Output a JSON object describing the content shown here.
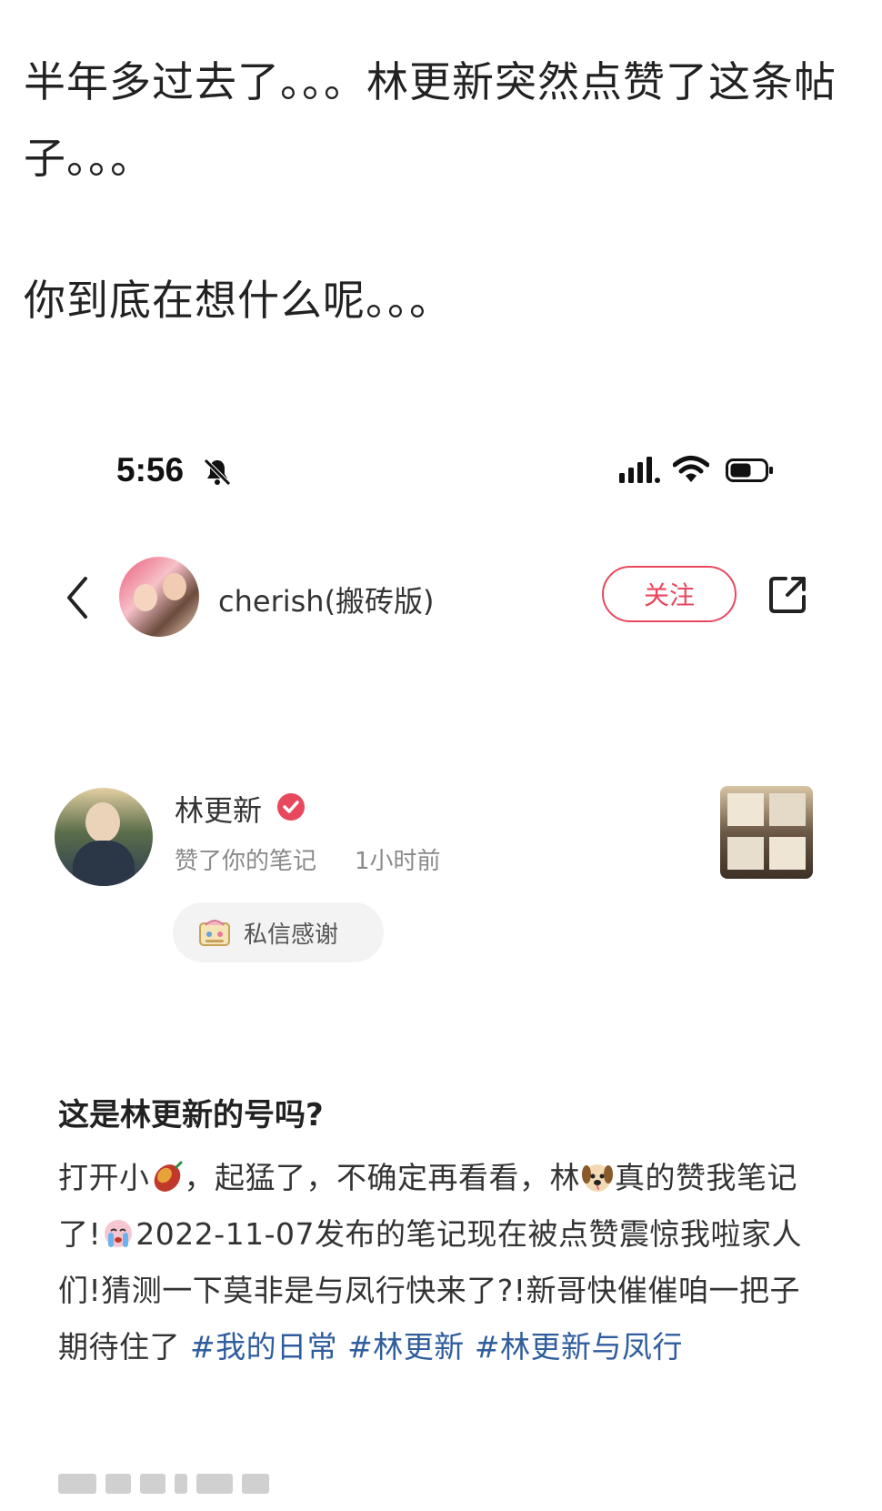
{
  "caption": {
    "line1": "半年多过去了。。。林更新突然点赞了这条帖子。。。",
    "line2": "你到底在想什么呢。。。"
  },
  "status_bar": {
    "time": "5:56",
    "icons": [
      "bell-slash-icon",
      "signal-icon",
      "wifi-icon",
      "battery-icon"
    ]
  },
  "header": {
    "back_icon": "chevron-left-icon",
    "username": "cherish(搬砖版)",
    "follow_label": "关注",
    "share_icon": "share-icon"
  },
  "notification": {
    "name": "林更新",
    "verified_icon": "verified-check-icon",
    "action": "赞了你的笔记",
    "time": "1小时前",
    "thanks_label": "私信感谢"
  },
  "post": {
    "title": "这是林更新的号吗?",
    "seg1": "打开小",
    "seg2": "，起猛了，不确定再看看，林",
    "seg3": "真的赞我笔记了!",
    "seg4": "2022-11-07发布的笔记现在被点赞震惊我啦家人们!猜测一下莫非是与凤行快来了?!新哥快催催咱一把子期待住了 ",
    "tags": [
      "#我的日常",
      "#林更新",
      "#林更新与凤行"
    ]
  },
  "colors": {
    "accent_red": "#e8485e",
    "tag_blue": "#2f5d9d"
  }
}
